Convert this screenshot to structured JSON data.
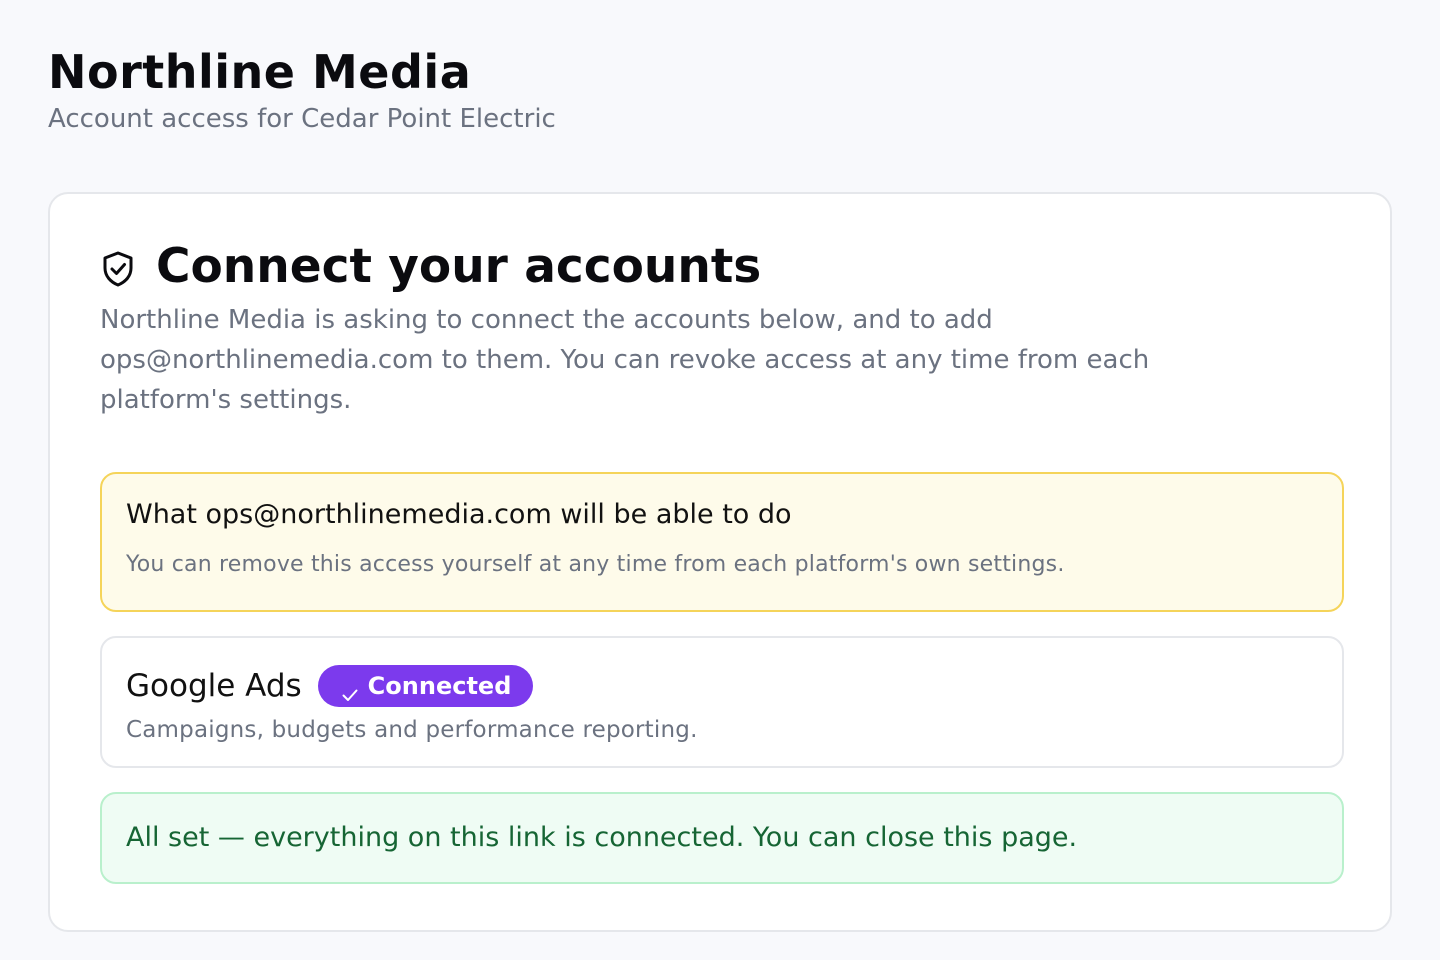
{
  "header": {
    "title": "Northline Media",
    "subtitle": "Account access for Cedar Point Electric"
  },
  "card": {
    "icon": "shield-check-icon",
    "title": "Connect your accounts",
    "description": "Northline Media is asking to connect the accounts below, and to add ops@northlinemedia.com to them. You can revoke access at any time from each platform's settings."
  },
  "notice": {
    "title": "What ops@northlinemedia.com will be able to do",
    "body": "You can remove this access yourself at any time from each platform's own settings.",
    "background": "#fefbea",
    "border": "#f5d45a"
  },
  "platforms": [
    {
      "name": "Google Ads",
      "status": "Connected",
      "status_icon": "check-icon",
      "description": "Campaigns, budgets and performance reporting.",
      "badge_color": "#7c3aed"
    }
  ],
  "success": {
    "text": "All set — everything on this link is connected. You can close this page.",
    "color": "#166534",
    "background": "#effcf4"
  }
}
